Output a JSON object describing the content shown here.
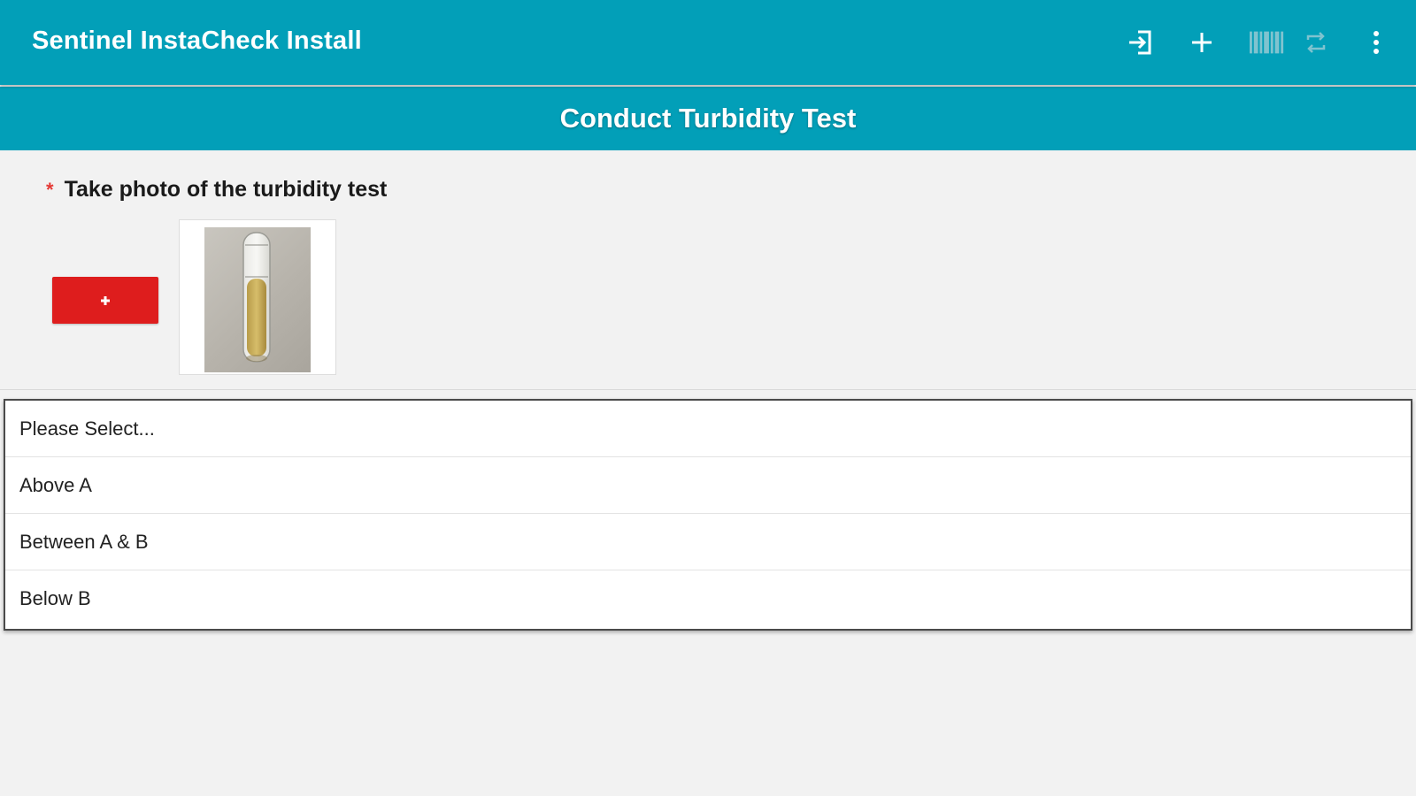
{
  "app": {
    "title": "Sentinel InstaCheck Install"
  },
  "toolbar": {
    "icons": [
      "exit-to-app-icon",
      "add-icon",
      "barcode-icon",
      "sync-icon",
      "more-vert-icon"
    ]
  },
  "page": {
    "title": "Conduct Turbidity Test"
  },
  "question": {
    "required_marker": "*",
    "label": "Take photo of the turbidity test",
    "photo_button_icon": "add-photo-icon"
  },
  "dropdown": {
    "options": [
      "Please Select...",
      "Above A",
      "Between A & B",
      "Below B"
    ]
  },
  "colors": {
    "primary": "#029fb8",
    "accent_red": "#de1d1d",
    "required": "#e53935",
    "background": "#f2f2f2"
  }
}
